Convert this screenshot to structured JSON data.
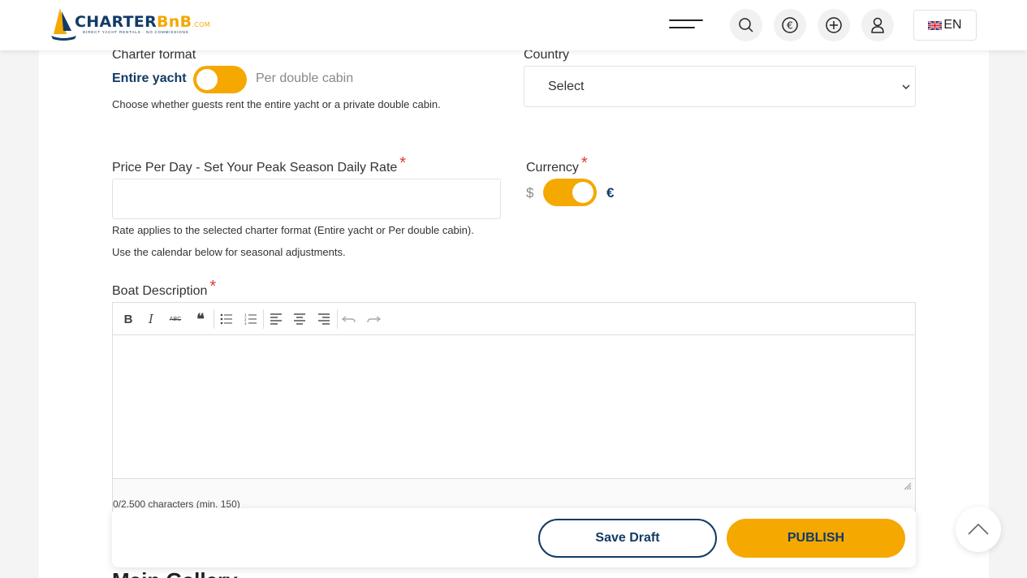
{
  "header": {
    "logo": {
      "part1": "CHARTER",
      "part2": "BnB",
      "suffix": ".COM",
      "tagline": "DIRECT YACHT RENTALS · NO COMMISSIONS"
    },
    "icons": [
      "menu-icon",
      "search-icon",
      "euro-icon",
      "add-icon",
      "user-icon"
    ],
    "language": "EN"
  },
  "charter_format": {
    "label": "Charter format",
    "required": "*",
    "option_on": "Entire yacht",
    "option_off": "Per double cabin",
    "hint": "Choose whether guests rent the entire yacht or a private double cabin."
  },
  "country": {
    "label": "Country",
    "required": "*",
    "selected": "Select"
  },
  "price": {
    "label": "Price Per Day - Set Your Peak Season Daily Rate",
    "required": "*",
    "value": "",
    "hint1": "Rate applies to the selected charter format (Entire yacht or Per double cabin).",
    "hint2": "Use the calendar below for seasonal adjustments."
  },
  "currency": {
    "label": "Currency",
    "required": "*",
    "left": "$",
    "right": "€"
  },
  "description": {
    "label": "Boat Description",
    "required": "*",
    "char_count": "0/2.500 characters (min. 150)",
    "toolbar": {
      "bold": "B",
      "italic": "I",
      "strike": "ABC",
      "quote": "❝"
    }
  },
  "actions": {
    "save_draft": "Save Draft",
    "publish": "PUBLISH"
  },
  "next_section": "Main Gallery",
  "colors": {
    "accent": "#f5a800",
    "navy": "#123b66",
    "required": "#e53935"
  }
}
